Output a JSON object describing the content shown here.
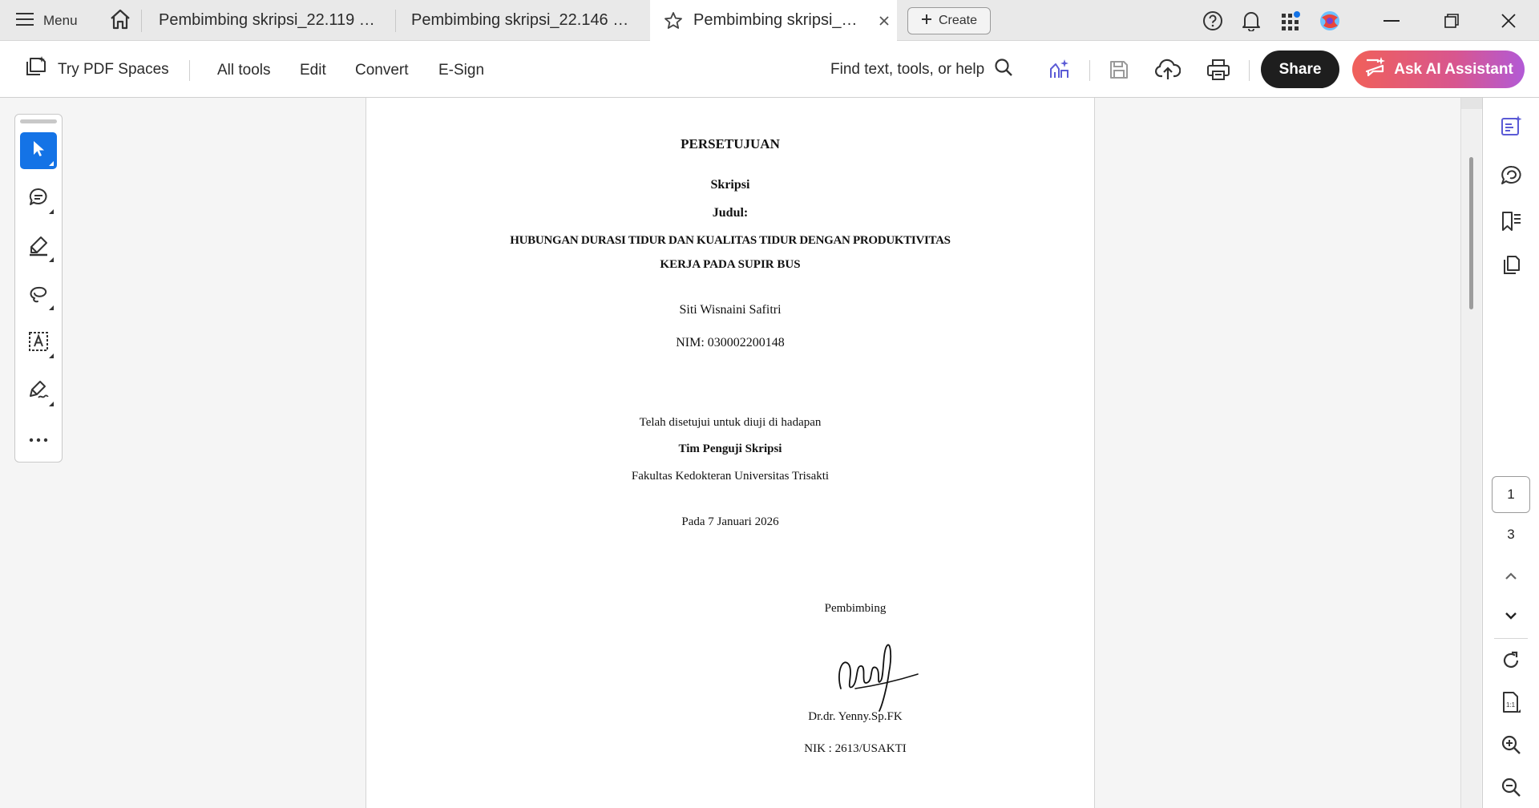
{
  "tabbar": {
    "menu_label": "Menu",
    "tabs": [
      {
        "label": "Pembimbing skripsi_22.119 Nas..."
      },
      {
        "label": "Pembimbing skripsi_22.146 Sal..."
      },
      {
        "label": "Pembimbing skripsi_22..."
      }
    ],
    "create_label": "Create"
  },
  "toolbar": {
    "try_spaces": "Try PDF Spaces",
    "menu": [
      "All tools",
      "Edit",
      "Convert",
      "E-Sign"
    ],
    "find_placeholder": "Find text, tools, or help",
    "share_label": "Share",
    "ai_label": "Ask AI Assistant"
  },
  "document": {
    "heading": "PERSETUJUAN",
    "type": "Skripsi",
    "judul_label": "Judul:",
    "title_line1": "HUBUNGAN DURASI TIDUR DAN KUALITAS TIDUR DENGAN PRODUKTIVITAS",
    "title_line2": "KERJA PADA SUPIR BUS",
    "author": "Siti Wisnaini Safitri",
    "nim": "NIM: 030002200148",
    "approved_line": "Telah disetujui untuk diuji di hadapan",
    "team": "Tim Penguji Skripsi",
    "faculty": "Fakultas Kedokteran Universitas Trisakti",
    "date": "Pada 7 Januari 2026",
    "supervisor_label": "Pembimbing",
    "supervisor_name": "Dr.dr. Yenny.Sp.FK",
    "supervisor_nik": "NIK : 2613/USAKTI"
  },
  "pagination": {
    "current_page": "1",
    "total_pages": "3"
  },
  "colors": {
    "accent": "#1473e6",
    "share_bg": "#1e1e1e",
    "ai_gradient_start": "#f0605a",
    "ai_gradient_end": "#b25ad6",
    "icon_purple": "#5b5bd6"
  }
}
